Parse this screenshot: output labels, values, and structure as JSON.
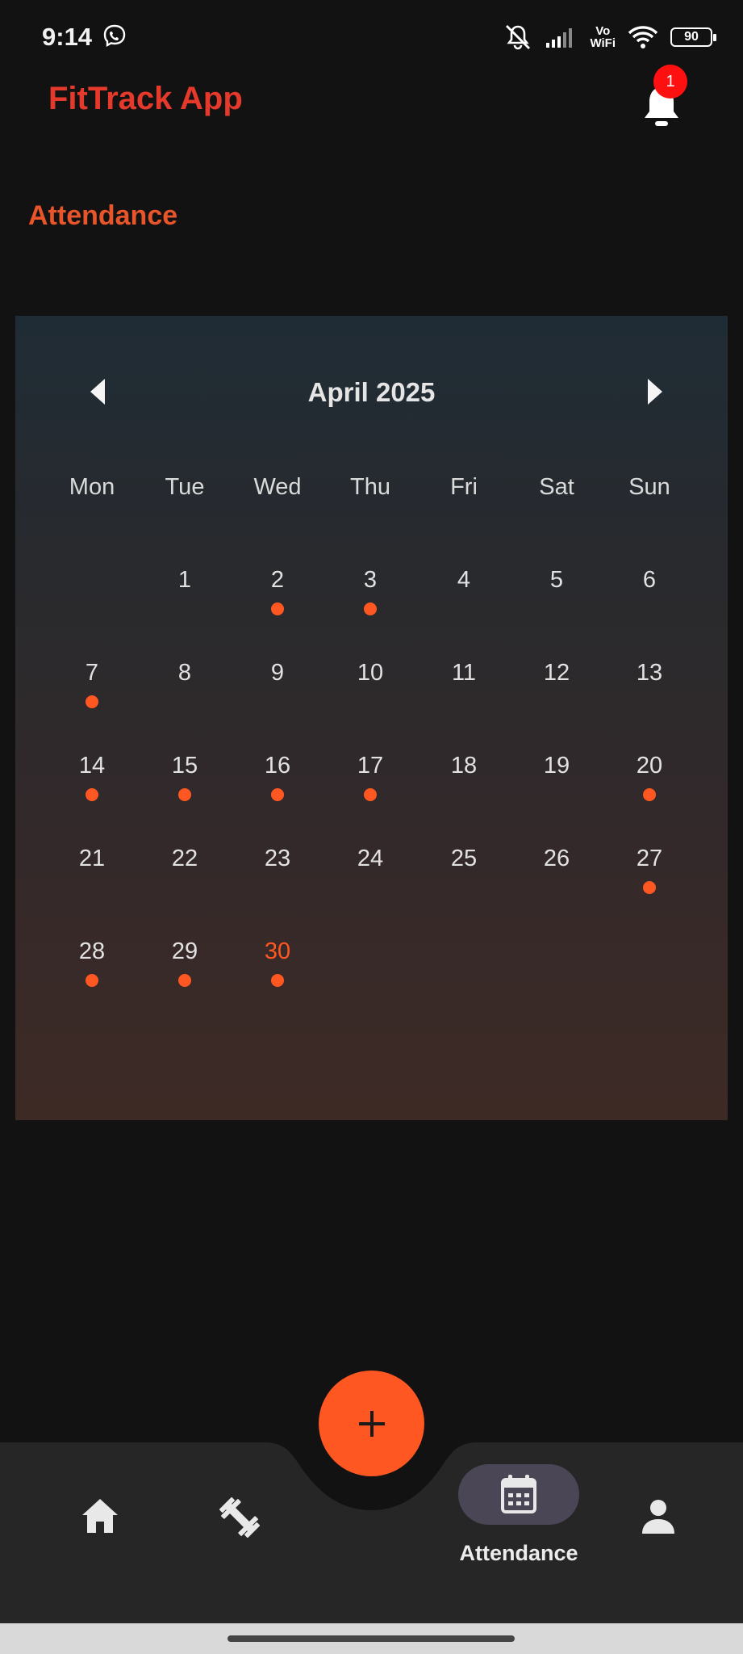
{
  "status_bar": {
    "time": "9:14",
    "network_label": "Vo\nWiFi",
    "battery": "90",
    "icons": [
      "viber-icon",
      "mute-icon",
      "signal-icon",
      "wifi-icon",
      "battery-icon"
    ]
  },
  "header": {
    "app_title": "FitTrack App",
    "notification_count": "1"
  },
  "page": {
    "section_title": "Attendance"
  },
  "calendar": {
    "month_label": "April 2025",
    "weekdays": [
      "Mon",
      "Tue",
      "Wed",
      "Thu",
      "Fri",
      "Sat",
      "Sun"
    ],
    "first_weekday_index": 1,
    "days_in_month": 30,
    "today": 30,
    "attended_days": [
      2,
      3,
      7,
      14,
      15,
      16,
      17,
      20,
      27,
      28,
      29,
      30
    ]
  },
  "fab": {
    "icon": "plus-icon"
  },
  "bottom_nav": {
    "items": [
      {
        "id": "home",
        "icon": "home-icon",
        "label": ""
      },
      {
        "id": "workouts",
        "icon": "dumbbell-icon",
        "label": ""
      },
      {
        "id": "attendance",
        "icon": "calendar-icon",
        "label": "Attendance",
        "active": true
      },
      {
        "id": "profile",
        "icon": "person-icon",
        "label": ""
      }
    ]
  },
  "colors": {
    "accent": "#ff5722",
    "title_red": "#e5392b",
    "background": "#121212",
    "nav_bg": "#262626",
    "active_pill": "#4a4656"
  }
}
